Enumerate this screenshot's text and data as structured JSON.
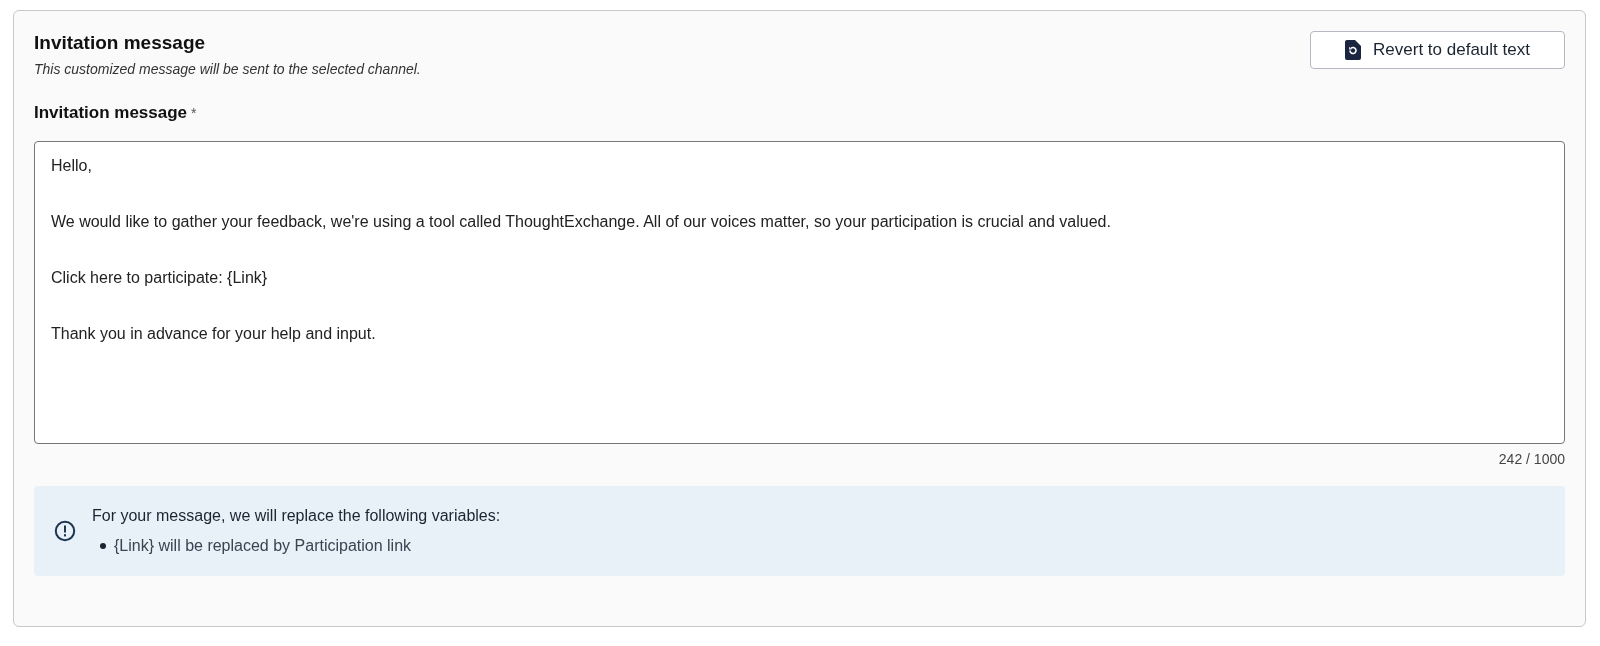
{
  "header": {
    "title": "Invitation message",
    "subtitle": "This customized message will be sent to the selected channel."
  },
  "revert_button": {
    "label": "Revert to default text"
  },
  "field": {
    "label": "Invitation message",
    "required_mark": "*",
    "value": "Hello,\n\nWe would like to gather your feedback, we're using a tool called ThoughtExchange. All of our voices matter, so your participation is crucial and valued.\n\nClick here to participate: {Link}\n\nThank you in advance for your help and input.",
    "counter": "242 / 1000"
  },
  "info": {
    "text": "For your message, we will replace the following variables:",
    "items": [
      "{Link} will be replaced by Participation link"
    ]
  }
}
